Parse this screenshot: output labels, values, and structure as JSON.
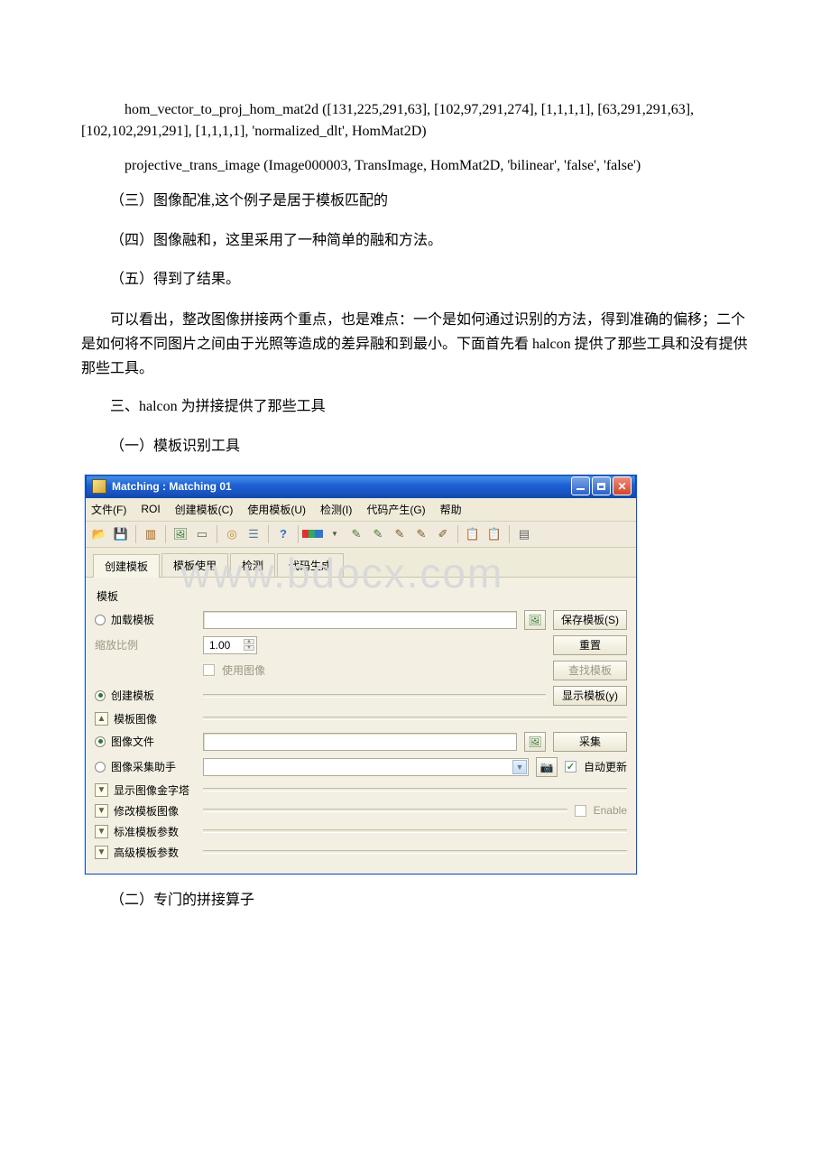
{
  "text": {
    "code_line1": "hom_vector_to_proj_hom_mat2d ([131,225,291,63], [102,97,291,274], [1,1,1,1], [63,291,291,63], [102,102,291,291], [1,1,1,1], 'normalized_dlt', HomMat2D)",
    "code_line2": "projective_trans_image (Image000003, TransImage, HomMat2D, 'bilinear', 'false', 'false')",
    "p3": "（三）图像配准,这个例子是居于模板匹配的",
    "p4": "（四）图像融和，这里采用了一种简单的融和方法。",
    "p5": "（五）得到了结果。",
    "p_summary": "可以看出，整改图像拼接两个重点，也是难点：一个是如何通过识别的方法，得到准确的偏移；二个是如何将不同图片之间由于光照等造成的差异融和到最小。下面首先看 halcon 提供了那些工具和没有提供那些工具。",
    "h3": "三、halcon 为拼接提供了那些工具",
    "s31": "（一）模板识别工具",
    "s32": "（二）专门的拼接算子",
    "watermark": "www.bdocx.com"
  },
  "window": {
    "title": "Matching : Matching 01",
    "menus": {
      "file": "文件(F)",
      "roi": "ROI",
      "create": "创建模板(C)",
      "use": "使用模板(U)",
      "inspect": "检测(I)",
      "codegen": "代码产生(G)",
      "help": "帮助"
    },
    "tabs": {
      "t1": "创建模板",
      "t2": "模板使用",
      "t3": "检测",
      "t4": "代码生成"
    },
    "labels": {
      "template": "模板",
      "load_template": "加载模板",
      "scale": "缩放比例",
      "scale_value": "1.00",
      "use_image": "使用图像",
      "create_template": "创建模板",
      "template_image": "模板图像",
      "image_file": "图像文件",
      "acq_assist": "图像采集助手",
      "show_pyramid": "显示图像金字塔",
      "modify_template_image": "修改模板图像",
      "std_params": "标准模板参数",
      "adv_params": "高级模板参数",
      "auto_update": "自动更新",
      "enable": "Enable"
    },
    "buttons": {
      "save_template": "保存模板(S)",
      "reset": "重置",
      "find_template": "查找模板",
      "display_template": "显示模板(y)",
      "acquire": "采集"
    }
  }
}
